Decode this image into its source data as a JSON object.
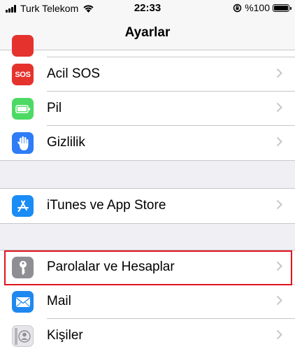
{
  "status_bar": {
    "carrier": "Turk Telekom",
    "time": "22:33",
    "battery": "%100"
  },
  "nav": {
    "title": "Ayarlar"
  },
  "groups": [
    {
      "items": [
        {
          "label": "Acil SOS",
          "icon": "sos-icon",
          "icon_text": "SOS",
          "color": "#e5322d"
        },
        {
          "label": "Pil",
          "icon": "battery-icon",
          "color": "#4cd964"
        },
        {
          "label": "Gizlilik",
          "icon": "hand-icon",
          "color": "#2e7cf6"
        }
      ]
    },
    {
      "items": [
        {
          "label": "iTunes ve App Store",
          "icon": "app-store-icon",
          "color": "#1a8cf5"
        }
      ]
    },
    {
      "items": [
        {
          "label": "Parolalar ve Hesaplar",
          "icon": "key-icon",
          "color": "#8e8e93",
          "highlighted": true
        },
        {
          "label": "Mail",
          "icon": "mail-icon",
          "color": "#1e88f0"
        },
        {
          "label": "Kişiler",
          "icon": "contacts-icon",
          "color": "#c9c9ce"
        }
      ]
    }
  ],
  "colors": {
    "highlight": "#e0141e",
    "chevron": "#c7c7cc",
    "background": "#efeff4"
  }
}
